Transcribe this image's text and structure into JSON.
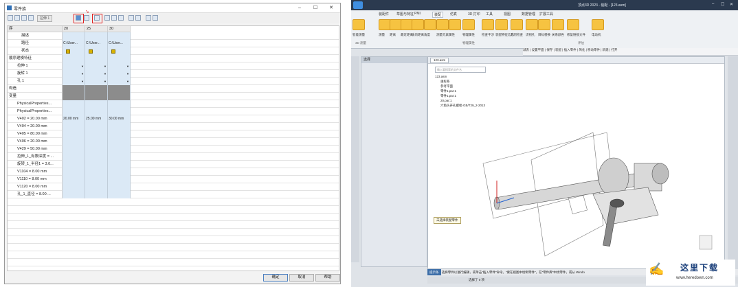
{
  "dialog": {
    "title": "零件族",
    "toolbar_text_button": "拉伸 1",
    "columns": [
      "序",
      "20",
      "25",
      "30"
    ],
    "rows": [
      {
        "label": "描述",
        "cells": [
          "",
          "",
          ""
        ]
      },
      {
        "label": "路径",
        "cells": [
          "C:\\User...",
          "C:\\User...",
          "C:\\User..."
        ]
      },
      {
        "label": "状态",
        "cells": [
          "",
          "",
          ""
        ]
      },
      {
        "label": "顺序建模特征",
        "cells": [
          "",
          "",
          ""
        ]
      },
      {
        "label": "拉伸 1",
        "cells": [
          "",
          "",
          ""
        ]
      },
      {
        "label": "旋转 1",
        "cells": [
          "",
          "",
          ""
        ]
      },
      {
        "label": "孔 1",
        "cells": [
          "",
          "",
          ""
        ]
      },
      {
        "label": "构造",
        "cells": [
          "",
          "",
          ""
        ]
      },
      {
        "label": "变量",
        "cells": [
          "",
          "",
          ""
        ]
      },
      {
        "label": "PhysicalProperties...",
        "cells": [
          "",
          "",
          ""
        ]
      },
      {
        "label": "PhysicalProperties...",
        "cells": [
          "",
          "",
          ""
        ]
      },
      {
        "label": "V402 = 20.00 mm",
        "cells": [
          "20.00 mm",
          "25.00 mm",
          "30.00 mm"
        ]
      },
      {
        "label": "V404 = 20.00 mm",
        "cells": [
          "",
          "",
          ""
        ]
      },
      {
        "label": "V405 = 80.00 mm",
        "cells": [
          "",
          "",
          ""
        ]
      },
      {
        "label": "V406 = 20.00 mm",
        "cells": [
          "",
          "",
          ""
        ]
      },
      {
        "label": "V429 = 50.00 mm",
        "cells": [
          "",
          "",
          ""
        ]
      },
      {
        "label": "拉伸_1_有限深度 = ...",
        "cells": [
          "",
          "",
          ""
        ]
      },
      {
        "label": "旋转_1_半径1 = 3.0...",
        "cells": [
          "",
          "",
          ""
        ]
      },
      {
        "label": "V1104 = 8.00 mm",
        "cells": [
          "",
          "",
          ""
        ]
      },
      {
        "label": "V1110 = 8.00 mm",
        "cells": [
          "",
          "",
          ""
        ]
      },
      {
        "label": "V1120 = 8.00 mm",
        "cells": [
          "",
          "",
          ""
        ]
      },
      {
        "label": "孔_1_直径 = 8.00 ...",
        "cells": [
          "",
          "",
          ""
        ]
      }
    ],
    "buttons": {
      "ok": "确定",
      "cancel": "取消",
      "help": "帮助"
    }
  },
  "app": {
    "title": "顶点3D 2023 - 装配 - [123.asm]",
    "tabs": [
      "装配件",
      "草图与特征",
      "PMI",
      "装配",
      "仿真",
      "3D 打印",
      "工具",
      "视图",
      "数据管理",
      "扩展工具"
    ],
    "ribbon_buttons": [
      "智能测量",
      "测量",
      "距离",
      "最近距离",
      "法向距离",
      "角度",
      "测量元素",
      "属性",
      "物理属性",
      "检查干涉",
      "装配特征信息",
      "几何检查",
      "识别孔",
      "目标替换",
      "关系颜色",
      "修复链接文件",
      "电动机"
    ],
    "ribbon_groups": [
      "3D 测量",
      "物理属性",
      "评估"
    ],
    "quick_bar": "减去 | 设置平面 | 保存 | 装配 | 插入零件 | 简化 | 移动零件 | 新建 | 打开",
    "left_panel_title": "选择",
    "doc_tab": "123.asm",
    "search_placeholder": "输入要搜索的文件名",
    "tree": [
      "123.asm",
      "坐标系",
      "参考平面",
      "零件1.par:1",
      "零件1.par:1",
      "20.par:1",
      "六角头开孔螺栓-GB/T29_2-2013"
    ],
    "view_tooltip": "未选择装配零件",
    "status_tab": "提示条",
    "status_text": "选择零件以进行编辑，或单击\"插入零件\"命令。\"要在视图中绘制零件\"，在\"零件库\"中找零件，或从 Windo",
    "status_sel": "选择了 0 项"
  },
  "watermark": {
    "line1": "这里下载",
    "line2": "www.heredown.com"
  }
}
